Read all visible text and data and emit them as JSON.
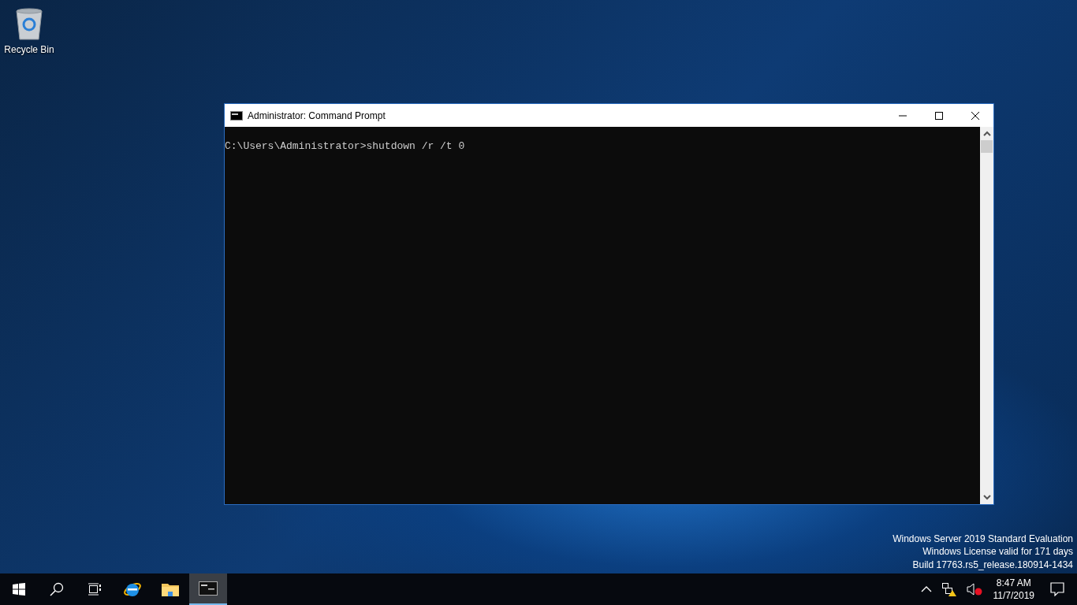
{
  "desktop_icons": [
    {
      "label": "Recycle Bin"
    }
  ],
  "window": {
    "title": "Administrator: Command Prompt",
    "lines": [
      "C:\\Users\\Administrator>shutdown /r /t 0"
    ]
  },
  "watermark_lines": [
    "Windows Server 2019 Standard Evaluation",
    "Windows License valid for 171 days",
    "Build 17763.rs5_release.180914-1434"
  ],
  "taskbar": {
    "apps": [
      {
        "kind": "browser",
        "selected": false
      },
      {
        "kind": "folder",
        "selected": false
      },
      {
        "kind": "console",
        "selected": true
      }
    ],
    "time": "8:47 AM",
    "date": "11/7/2019"
  }
}
